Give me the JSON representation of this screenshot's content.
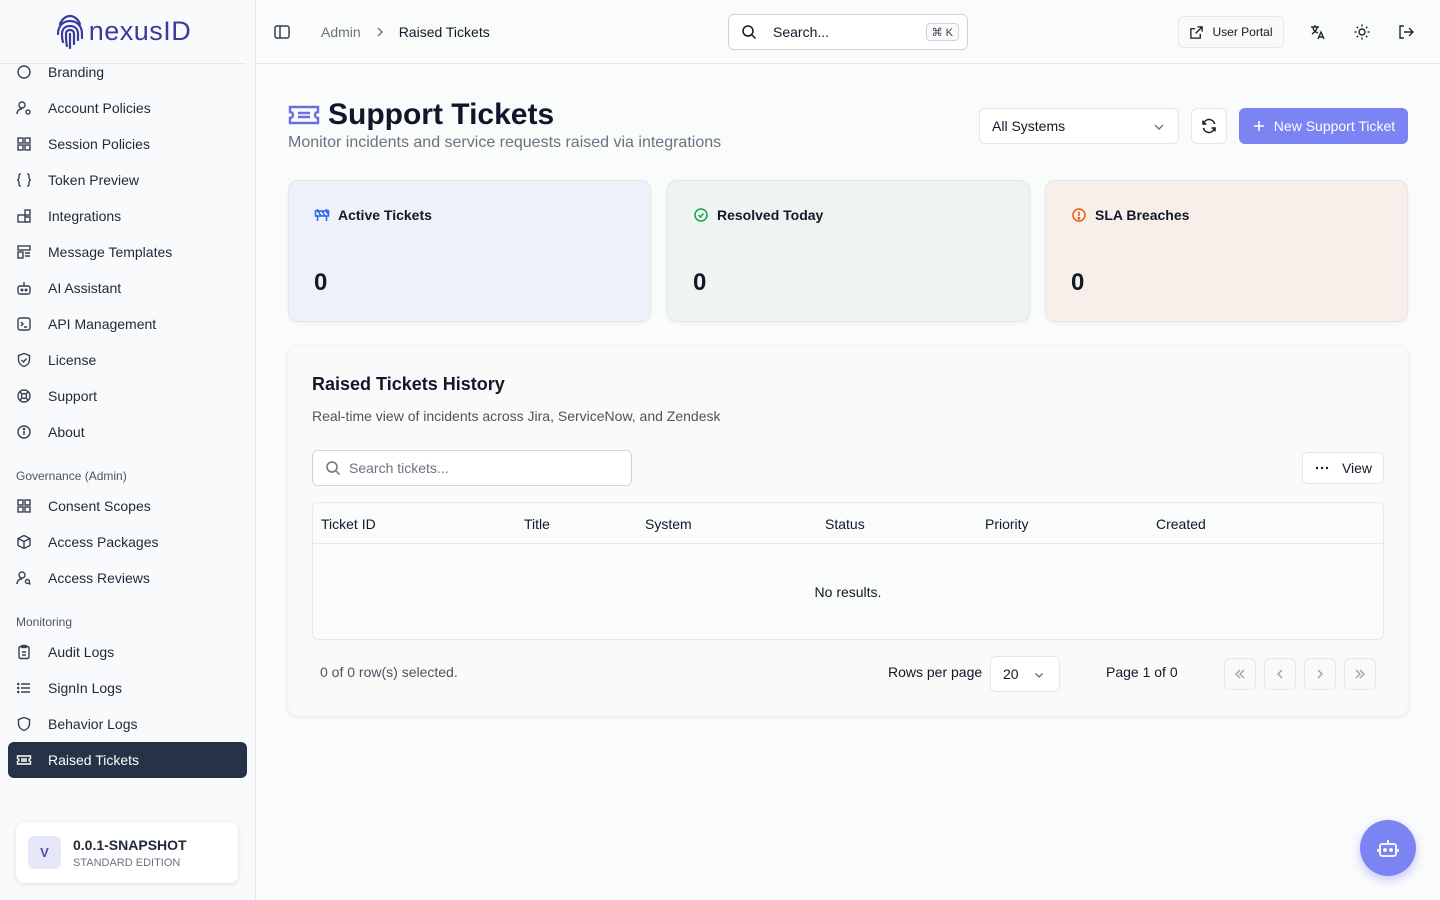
{
  "app": {
    "brand": "nexusID"
  },
  "sidebar": {
    "partial_item": "Branding",
    "items": [
      {
        "label": "Account Policies",
        "icon": "user-cog-icon"
      },
      {
        "label": "Session Policies",
        "icon": "grid-icon"
      },
      {
        "label": "Token Preview",
        "icon": "braces-icon"
      },
      {
        "label": "Integrations",
        "icon": "blocks-icon"
      },
      {
        "label": "Message Templates",
        "icon": "template-icon"
      },
      {
        "label": "AI Assistant",
        "icon": "bot-icon"
      },
      {
        "label": "API Management",
        "icon": "terminal-icon"
      },
      {
        "label": "License",
        "icon": "shield-check-icon"
      },
      {
        "label": "Support",
        "icon": "lifebuoy-icon"
      },
      {
        "label": "About",
        "icon": "info-icon"
      }
    ],
    "governance_label": "Governance (Admin)",
    "governance": [
      {
        "label": "Consent Scopes",
        "icon": "grid-icon"
      },
      {
        "label": "Access Packages",
        "icon": "package-icon"
      },
      {
        "label": "Access Reviews",
        "icon": "user-search-icon"
      }
    ],
    "monitoring_label": "Monitoring",
    "monitoring": [
      {
        "label": "Audit Logs",
        "icon": "clipboard-icon"
      },
      {
        "label": "SignIn Logs",
        "icon": "list-icon"
      },
      {
        "label": "Behavior Logs",
        "icon": "shield-icon"
      },
      {
        "label": "Raised Tickets",
        "icon": "ticket-icon",
        "active": true
      }
    ],
    "version": {
      "badge": "V",
      "title": "0.0.1-SNAPSHOT",
      "edition": "STANDARD EDITION"
    }
  },
  "header": {
    "breadcrumb": [
      "Admin",
      "Raised Tickets"
    ],
    "search_placeholder": "Search...",
    "shortcut": "⌘ K",
    "user_portal": "User Portal"
  },
  "main": {
    "title": "Support Tickets",
    "subtitle": "Monitor incidents and service requests raised via integrations",
    "system_filter": "All Systems",
    "new_ticket": "New Support Ticket",
    "stats": [
      {
        "label": "Active Tickets",
        "value": "0",
        "color": "#2563eb",
        "bg": "#edf1f9"
      },
      {
        "label": "Resolved Today",
        "value": "0",
        "color": "#16a34a",
        "bg": "#edf4f1"
      },
      {
        "label": "SLA Breaches",
        "value": "0",
        "color": "#ea580c",
        "bg": "#f8efea"
      }
    ]
  },
  "history": {
    "title": "Raised Tickets History",
    "subtitle": "Real-time view of incidents across Jira, ServiceNow, and Zendesk",
    "search_placeholder": "Search tickets...",
    "view_label": "View",
    "columns": [
      "Ticket ID",
      "Title",
      "System",
      "Status",
      "Priority",
      "Created"
    ],
    "empty_text": "No results.",
    "selection_text": "0 of 0 row(s) selected.",
    "rows_per_page_label": "Rows per page",
    "rows_per_page": "20",
    "page_text": "Page 1 of 0"
  },
  "colors": {
    "accent": "#7c83f2",
    "active_nav": "#263246",
    "brand": "#3b3a9e"
  }
}
